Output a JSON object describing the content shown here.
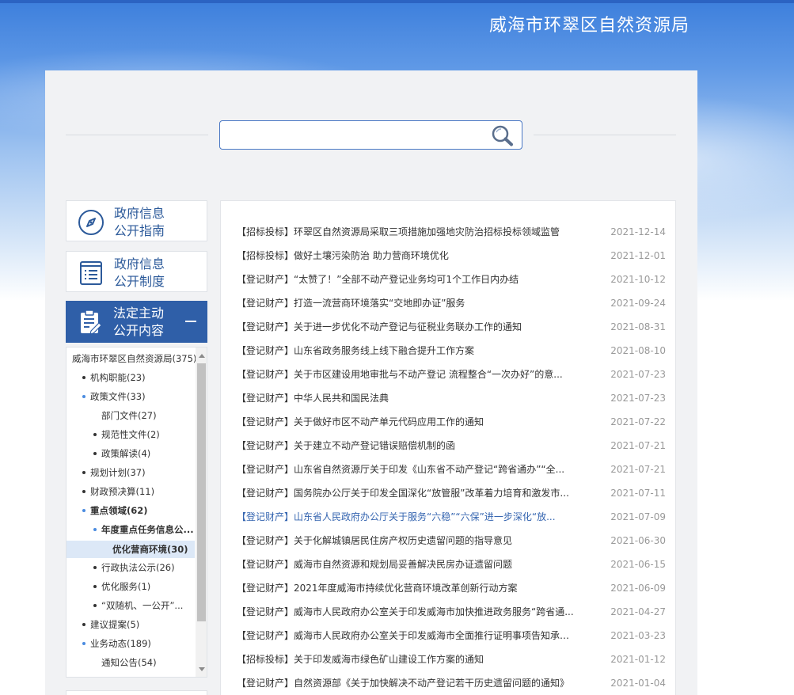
{
  "header": {
    "site_title": "威海市环翠区自然资源局"
  },
  "search": {
    "value": "",
    "placeholder": ""
  },
  "sidebar": {
    "cards": [
      {
        "icon": "compass-icon",
        "label_line1": "政府信息",
        "label_line2": "公开指南"
      },
      {
        "icon": "document-list-icon",
        "label_line1": "政府信息",
        "label_line2": "公开制度"
      },
      {
        "icon": "clipboard-edit-icon",
        "label_line1": "法定主动",
        "label_line2": "公开内容"
      }
    ],
    "tree": [
      {
        "label": "威海市环翠区自然资源局(375)",
        "level": 0,
        "dot": "none",
        "bold": false
      },
      {
        "label": "机构职能(23)",
        "level": 1,
        "dot": "dark",
        "bold": false
      },
      {
        "label": "政策文件(33)",
        "level": 1,
        "dot": "blue",
        "bold": false
      },
      {
        "label": "部门文件(27)",
        "level": 2,
        "dot": "none",
        "bold": false
      },
      {
        "label": "规范性文件(2)",
        "level": 2,
        "dot": "dark",
        "bold": false
      },
      {
        "label": "政策解读(4)",
        "level": 2,
        "dot": "dark",
        "bold": false
      },
      {
        "label": "规划计划(37)",
        "level": 1,
        "dot": "dark",
        "bold": false
      },
      {
        "label": "财政预决算(11)",
        "level": 1,
        "dot": "dark",
        "bold": false
      },
      {
        "label": "重点领域(62)",
        "level": 1,
        "dot": "blue",
        "bold": true
      },
      {
        "label": "年度重点任务信息公...",
        "level": 2,
        "dot": "blue",
        "bold": true
      },
      {
        "label": "优化营商环境(30)",
        "level": 3,
        "dot": "none",
        "bold": true
      },
      {
        "label": "行政执法公示(26)",
        "level": 2,
        "dot": "dark",
        "bold": false
      },
      {
        "label": "优化服务(1)",
        "level": 2,
        "dot": "dark",
        "bold": false
      },
      {
        "label": "“双随机、一公开”...",
        "level": 2,
        "dot": "dark",
        "bold": false
      },
      {
        "label": "建议提案(5)",
        "level": 1,
        "dot": "dark",
        "bold": false
      },
      {
        "label": "业务动态(189)",
        "level": 1,
        "dot": "blue",
        "bold": false
      },
      {
        "label": "通知公告(54)",
        "level": 2,
        "dot": "none",
        "bold": false
      }
    ]
  },
  "list": [
    {
      "title": "【招标投标】环翠区自然资源局采取三项措施加强地灾防治招标投标领域监管",
      "date": "2021-12-14"
    },
    {
      "title": "【招标投标】做好土壤污染防治 助力营商环境优化",
      "date": "2021-12-01"
    },
    {
      "title": "【登记财产】“太赞了！”全部不动产登记业务均可1个工作日内办结",
      "date": "2021-10-12"
    },
    {
      "title": "【登记财产】打造一流营商环境落实“交地即办证”服务",
      "date": "2021-09-24"
    },
    {
      "title": "【登记财产】关于进一步优化不动产登记与征税业务联办工作的通知",
      "date": "2021-08-31"
    },
    {
      "title": "【登记财产】山东省政务服务线上线下融合提升工作方案",
      "date": "2021-08-10"
    },
    {
      "title": "【登记财产】关于市区建设用地审批与不动产登记 流程整合“一次办好”的意...",
      "date": "2021-07-23"
    },
    {
      "title": "【登记财产】中华人民共和国民法典",
      "date": "2021-07-23"
    },
    {
      "title": "【登记财产】关于做好市区不动产单元代码应用工作的通知",
      "date": "2021-07-22"
    },
    {
      "title": "【登记财产】关于建立不动产登记错误赔偿机制的函",
      "date": "2021-07-21"
    },
    {
      "title": "【登记财产】山东省自然资源厅关于印发《山东省不动产登记“跨省通办”“全...",
      "date": "2021-07-21"
    },
    {
      "title": "【登记财产】国务院办公厅关于印发全国深化“放管服”改革着力培育和激发市...",
      "date": "2021-07-11"
    },
    {
      "title": "【登记财产】山东省人民政府办公厅关于服务“六稳”“六保”进一步深化“放...",
      "date": "2021-07-09",
      "highlight": true
    },
    {
      "title": "【登记财产】关于化解城镇居民住房产权历史遗留问题的指导意见",
      "date": "2021-06-30"
    },
    {
      "title": "【登记财产】威海市自然资源和规划局妥善解决民房办证遗留问题",
      "date": "2021-06-15"
    },
    {
      "title": "【登记财产】2021年度威海市持续优化营商环境改革创新行动方案",
      "date": "2021-06-09"
    },
    {
      "title": "【登记财产】威海市人民政府办公室关于印发威海市加快推进政务服务“跨省通...",
      "date": "2021-04-27"
    },
    {
      "title": "【登记财产】威海市人民政府办公室关于印发威海市全面推行证明事项告知承诺...",
      "date": "2021-03-23"
    },
    {
      "title": "【招标投标】关于印发威海市绿色矿山建设工作方案的通知",
      "date": "2021-01-12"
    },
    {
      "title": "【登记财产】自然资源部《关于加快解决不动产登记若干历史遗留问题的通知》",
      "date": "2021-01-04"
    }
  ],
  "colors": {
    "accent": "#2f5fa8",
    "link": "#3565b0",
    "date": "#999999",
    "selected_bg": "#dce8f7"
  }
}
